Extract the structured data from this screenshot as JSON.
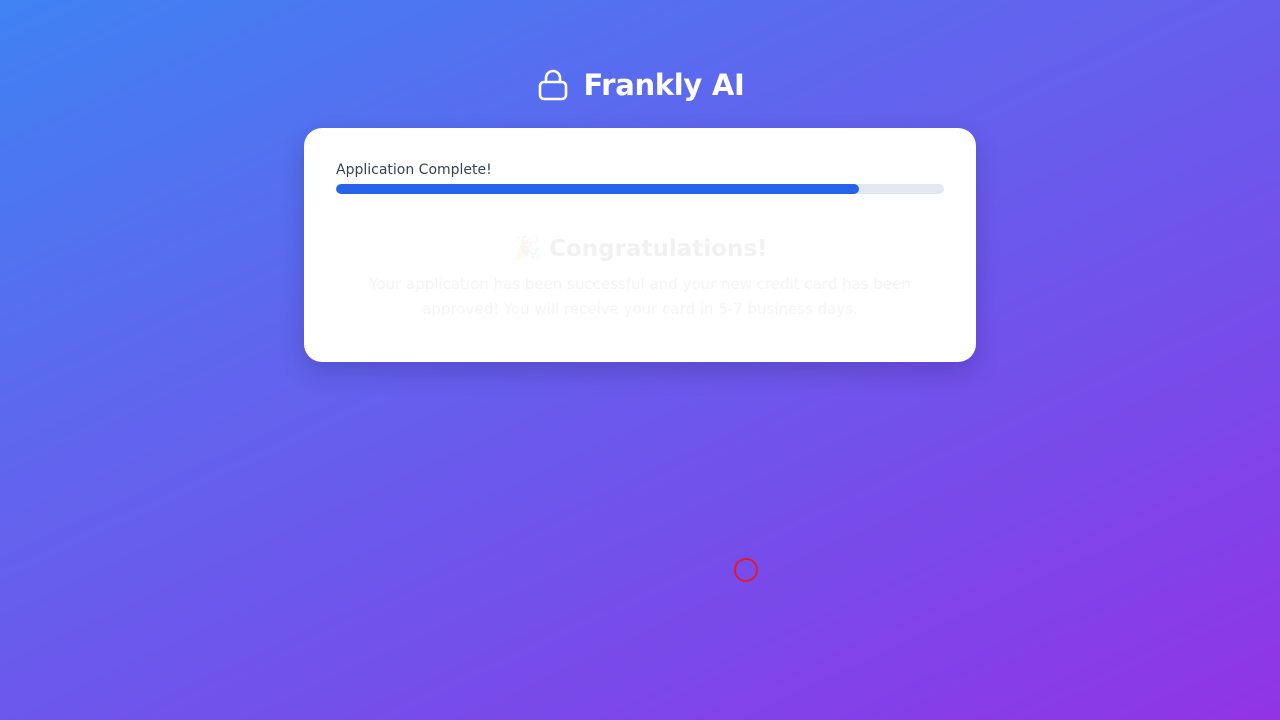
{
  "app": {
    "title": "Frankly AI",
    "logo_icon": "lock-icon"
  },
  "progress": {
    "label": "Application Complete!",
    "percent": 86,
    "fill_color": "#2563eb",
    "track_color": "#e2e8f0"
  },
  "congrats": {
    "title": "🎉 Congratulations!",
    "message": "Your application has been successful and your new credit card has been approved! You will receive your card in 5-7 business days."
  },
  "colors": {
    "background_start": "#3f82f4",
    "background_end": "#9134e6",
    "cursor_marker": "#e01b2f"
  }
}
